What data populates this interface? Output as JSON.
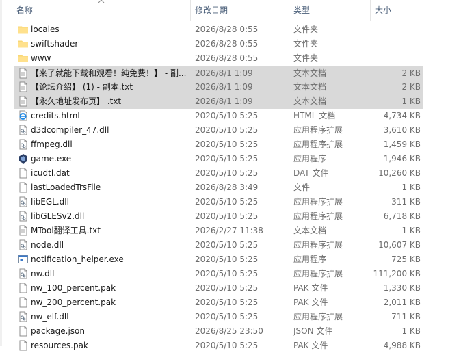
{
  "header": {
    "name": "名称",
    "date": "修改日期",
    "type": "类型",
    "size": "大小"
  },
  "files": [
    {
      "name": "locales",
      "date": "2026/8/28 0:55",
      "type": "文件夹",
      "size": "",
      "icon": "folder-icon",
      "state": "normal"
    },
    {
      "name": "swiftshader",
      "date": "2026/8/28 0:55",
      "type": "文件夹",
      "size": "",
      "icon": "folder-icon",
      "state": "normal"
    },
    {
      "name": "www",
      "date": "2026/8/28 0:55",
      "type": "文件夹",
      "size": "",
      "icon": "folder-icon",
      "state": "normal"
    },
    {
      "name": "【来了就能下载和观看！纯免费！】 - 副...",
      "date": "2026/8/1 1:09",
      "type": "文本文档",
      "size": "2 KB",
      "icon": "text-file-icon",
      "state": "selected"
    },
    {
      "name": "【论坛介绍】 (1) - 副本.txt",
      "date": "2026/8/1 1:09",
      "type": "文本文档",
      "size": "2 KB",
      "icon": "text-file-icon",
      "state": "selected"
    },
    {
      "name": "【永久地址发布页】 .txt",
      "date": "2026/8/1 1:09",
      "type": "文本文档",
      "size": "1 KB",
      "icon": "text-file-icon",
      "state": "selected"
    },
    {
      "name": "credits.html",
      "date": "2020/5/10 5:25",
      "type": "HTML 文档",
      "size": "4,734 KB",
      "icon": "html-file-icon",
      "state": "normal"
    },
    {
      "name": "d3dcompiler_47.dll",
      "date": "2020/5/10 5:25",
      "type": "应用程序扩展",
      "size": "3,610 KB",
      "icon": "dll-file-icon",
      "state": "normal"
    },
    {
      "name": "ffmpeg.dll",
      "date": "2020/5/10 5:25",
      "type": "应用程序扩展",
      "size": "1,459 KB",
      "icon": "dll-file-icon",
      "state": "normal"
    },
    {
      "name": "game.exe",
      "date": "2020/5/10 5:25",
      "type": "应用程序",
      "size": "1,946 KB",
      "icon": "game-exe-icon",
      "state": "normal"
    },
    {
      "name": "icudtl.dat",
      "date": "2020/5/10 5:25",
      "type": "DAT 文件",
      "size": "10,260 KB",
      "icon": "blank-file-icon",
      "state": "normal"
    },
    {
      "name": "lastLoadedTrsFile",
      "date": "2026/8/28 3:49",
      "type": "文件",
      "size": "1 KB",
      "icon": "blank-file-icon",
      "state": "normal"
    },
    {
      "name": "libEGL.dll",
      "date": "2020/5/10 5:25",
      "type": "应用程序扩展",
      "size": "311 KB",
      "icon": "dll-file-icon",
      "state": "normal"
    },
    {
      "name": "libGLESv2.dll",
      "date": "2020/5/10 5:25",
      "type": "应用程序扩展",
      "size": "6,718 KB",
      "icon": "dll-file-icon",
      "state": "normal"
    },
    {
      "name": "MTool翻译工具.txt",
      "date": "2026/2/27 11:38",
      "type": "文本文档",
      "size": "1 KB",
      "icon": "text-file-icon",
      "state": "normal"
    },
    {
      "name": "node.dll",
      "date": "2020/5/10 5:25",
      "type": "应用程序扩展",
      "size": "10,607 KB",
      "icon": "dll-file-icon",
      "state": "normal"
    },
    {
      "name": "notification_helper.exe",
      "date": "2020/5/10 5:25",
      "type": "应用程序",
      "size": "725 KB",
      "icon": "exe-file-icon",
      "state": "normal"
    },
    {
      "name": "nw.dll",
      "date": "2020/5/10 5:25",
      "type": "应用程序扩展",
      "size": "111,200 KB",
      "icon": "dll-file-icon",
      "state": "normal"
    },
    {
      "name": "nw_100_percent.pak",
      "date": "2020/5/10 5:25",
      "type": "PAK 文件",
      "size": "1,330 KB",
      "icon": "blank-file-icon",
      "state": "normal"
    },
    {
      "name": "nw_200_percent.pak",
      "date": "2020/5/10 5:25",
      "type": "PAK 文件",
      "size": "2,011 KB",
      "icon": "blank-file-icon",
      "state": "normal"
    },
    {
      "name": "nw_elf.dll",
      "date": "2020/5/10 5:25",
      "type": "应用程序扩展",
      "size": "711 KB",
      "icon": "dll-file-icon",
      "state": "normal"
    },
    {
      "name": "package.json",
      "date": "2026/8/25 23:50",
      "type": "JSON 文件",
      "size": "1 KB",
      "icon": "blank-file-icon",
      "state": "normal"
    },
    {
      "name": "resources.pak",
      "date": "2020/5/10 5:25",
      "type": "PAK 文件",
      "size": "4,988 KB",
      "icon": "blank-file-icon",
      "state": "normal"
    }
  ]
}
